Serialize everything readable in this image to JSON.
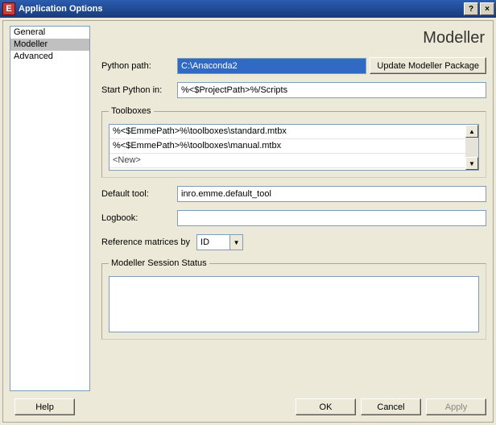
{
  "window": {
    "icon_letter": "E",
    "title": "Application Options",
    "help_btn": "?",
    "close_btn": "×"
  },
  "sidebar": {
    "items": [
      {
        "label": "General",
        "selected": false
      },
      {
        "label": "Modeller",
        "selected": true
      },
      {
        "label": "Advanced",
        "selected": false
      }
    ]
  },
  "page": {
    "title": "Modeller",
    "python_path_label": "Python path:",
    "python_path_value": "C:\\Anaconda2",
    "update_pkg_label": "Update Modeller Package",
    "start_python_label": "Start Python in:",
    "start_python_value": "%<$ProjectPath>%/Scripts",
    "toolboxes_legend": "Toolboxes",
    "toolboxes": [
      "%<$EmmePath>%\\toolboxes\\standard.mtbx",
      "%<$EmmePath>%\\toolboxes\\manual.mtbx",
      "<New>"
    ],
    "default_tool_label": "Default tool:",
    "default_tool_value": "inro.emme.default_tool",
    "logbook_label": "Logbook:",
    "logbook_value": "",
    "ref_matrices_label": "Reference matrices by",
    "ref_matrices_value": "ID",
    "session_legend": "Modeller Session Status"
  },
  "buttons": {
    "help": "Help",
    "ok": "OK",
    "cancel": "Cancel",
    "apply": "Apply"
  }
}
